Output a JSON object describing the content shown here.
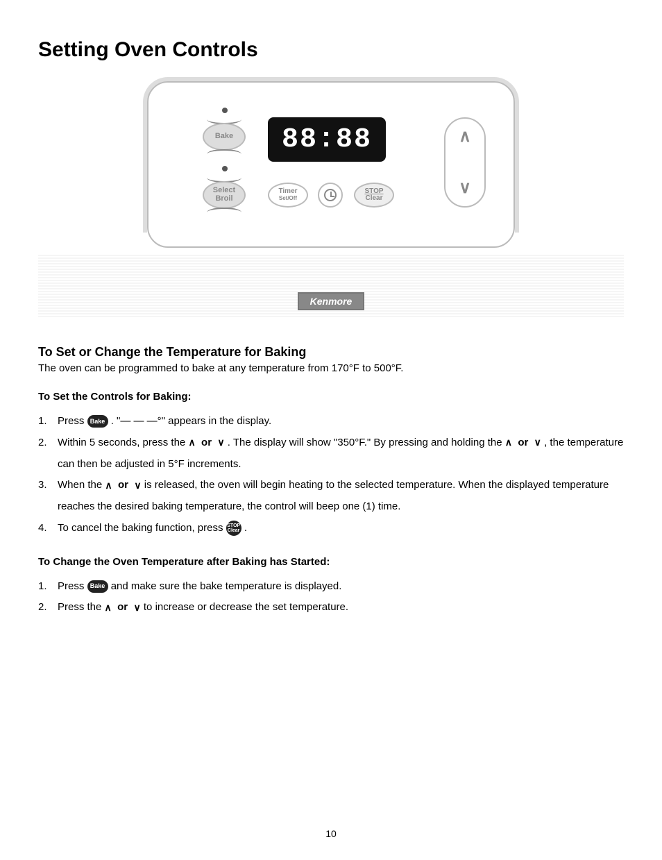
{
  "title": "Setting Oven Controls",
  "panel": {
    "bake": "Bake",
    "broil_line1": "Select",
    "broil_line2": "Broil",
    "display": "88:88",
    "timer_line1": "Timer",
    "timer_line2": "Set/Off",
    "stop_line1": "STOP",
    "stop_line2": "Clear"
  },
  "brand": "Kenmore",
  "section1_heading": "To Set or Change the Temperature for Baking",
  "section1_intro": "The oven can be programmed to bake at any temperature from 170°F to 500°F.",
  "baking_heading": "To Set the Controls for Baking:",
  "baking_steps": {
    "s1a": "Press ",
    "s1b": " . \"— — —°\" appears in the display.",
    "s2a": "Within 5 seconds, press the ",
    "s2b": " . The display will show \"350°F.\" By pressing and holding the ",
    "s2c": " , the temperature can then be adjusted in 5°F increments.",
    "s3a": "When the ",
    "s3b": " is released, the oven will begin heating to the selected temperature. When the displayed temperature reaches the desired baking temperature, the control will beep one (1) time.",
    "s4a": "To cancel the baking function, press ",
    "s4b": " ."
  },
  "change_heading": "To Change the Oven Temperature after Baking has Started:",
  "change_steps": {
    "c1a": "Press ",
    "c1b": " and make sure the bake temperature is displayed.",
    "c2a": "Press the ",
    "c2b": " to increase or decrease the set temperature."
  },
  "common": {
    "or": "or",
    "bake_icon": "Bake",
    "stop_icon": "STOP\nClear"
  },
  "nums": {
    "n1": "1.",
    "n2": "2.",
    "n3": "3.",
    "n4": "4."
  },
  "page_number": "10"
}
